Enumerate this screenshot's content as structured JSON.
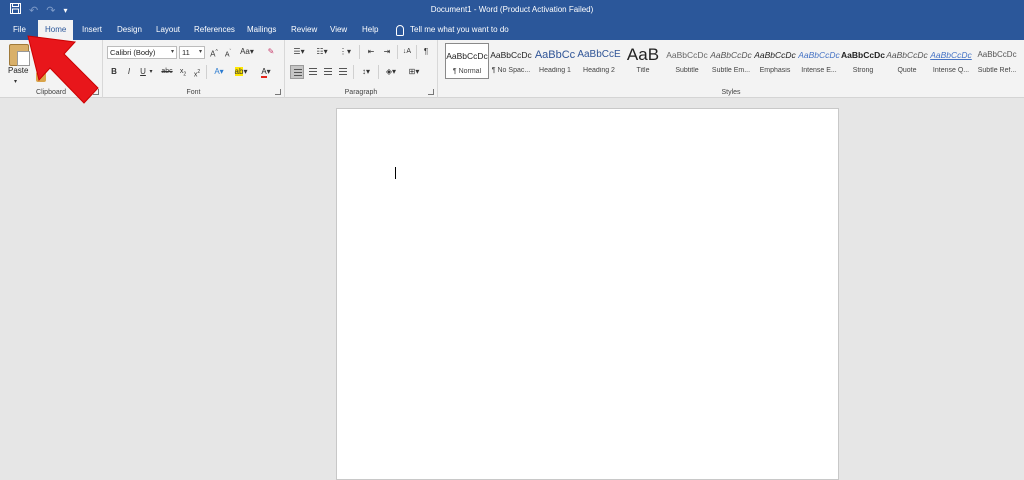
{
  "window": {
    "title": "Document1  -  Word (Product Activation Failed)"
  },
  "qat": {
    "save_icon": "save-icon",
    "undo_icon": "undo-icon",
    "redo_icon": "redo-icon",
    "customize_icon": "customize-icon"
  },
  "tabs": [
    {
      "label": "File"
    },
    {
      "label": "Home",
      "active": true
    },
    {
      "label": "Insert"
    },
    {
      "label": "Design"
    },
    {
      "label": "Layout"
    },
    {
      "label": "References"
    },
    {
      "label": "Mailings"
    },
    {
      "label": "Review"
    },
    {
      "label": "View"
    },
    {
      "label": "Help"
    }
  ],
  "tellme": {
    "label": "Tell me what you want to do"
  },
  "ribbon": {
    "clipboard": {
      "group_label": "Clipboard",
      "paste_label": "Paste",
      "painter_label": "inter"
    },
    "font": {
      "group_label": "Font",
      "font_name": "Calibri (Body)",
      "font_size": "11"
    },
    "paragraph": {
      "group_label": "Paragraph"
    },
    "styles": {
      "group_label": "Styles",
      "items": [
        {
          "preview": "AaBbCcDc",
          "name": "¶ Normal"
        },
        {
          "preview": "AaBbCcDc",
          "name": "¶ No Spac..."
        },
        {
          "preview": "AaBbCc",
          "name": "Heading 1"
        },
        {
          "preview": "AaBbCcE",
          "name": "Heading 2"
        },
        {
          "preview": "AaB",
          "name": "Title"
        },
        {
          "preview": "AaBbCcDc",
          "name": "Subtitle"
        },
        {
          "preview": "AaBbCcDc",
          "name": "Subtle Em..."
        },
        {
          "preview": "AaBbCcDc",
          "name": "Emphasis"
        },
        {
          "preview": "AaBbCcDc",
          "name": "Intense E..."
        },
        {
          "preview": "AaBbCcDc",
          "name": "Strong"
        },
        {
          "preview": "AaBbCcDc",
          "name": "Quote"
        },
        {
          "preview": "AaBbCcDc",
          "name": "Intense Q..."
        },
        {
          "preview": "AaBbCcDc",
          "name": "Subtle Ref..."
        }
      ]
    }
  },
  "colors": {
    "accent": "#2b579a",
    "arrow": "#e8161b"
  }
}
